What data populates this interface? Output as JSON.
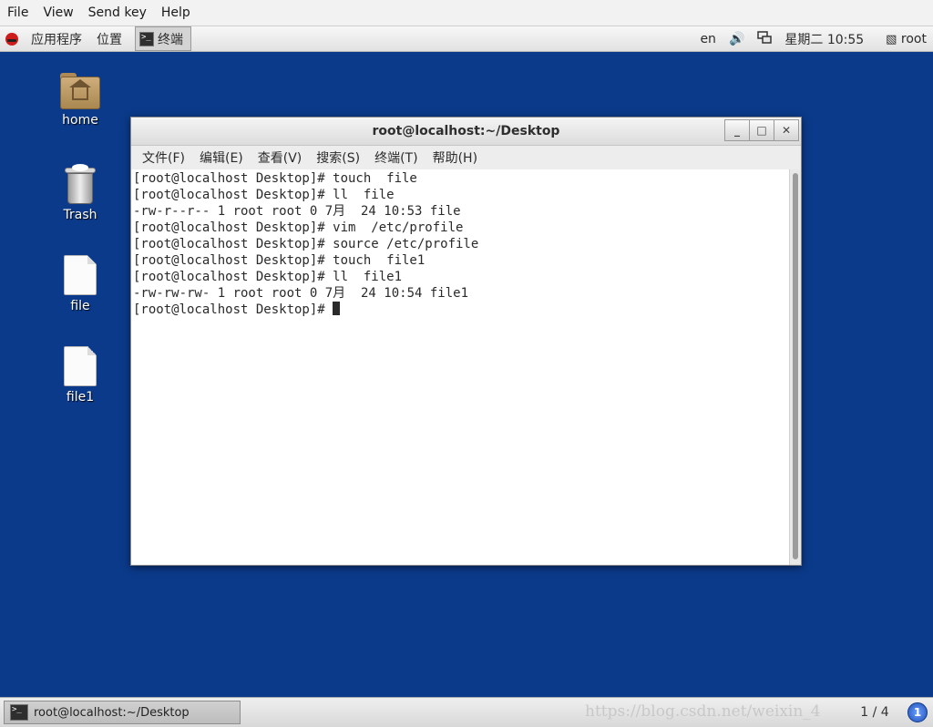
{
  "vm_menubar": {
    "items": [
      "File",
      "View",
      "Send key",
      "Help"
    ]
  },
  "top_panel": {
    "applications": "应用程序",
    "places": "位置",
    "terminal_task": "终端",
    "language": "en",
    "clock": "星期二 10:55",
    "user": "root"
  },
  "desktop": {
    "icons": [
      {
        "label": "home",
        "icon": "home-folder-icon"
      },
      {
        "label": "Trash",
        "icon": "trash-icon"
      },
      {
        "label": "file",
        "icon": "document-icon"
      },
      {
        "label": "file1",
        "icon": "document-icon"
      }
    ]
  },
  "terminal": {
    "title": "root@localhost:~/Desktop",
    "menus": [
      "文件(F)",
      "编辑(E)",
      "查看(V)",
      "搜索(S)",
      "终端(T)",
      "帮助(H)"
    ],
    "lines": [
      "[root@localhost Desktop]# touch  file",
      "[root@localhost Desktop]# ll  file",
      "-rw-r--r-- 1 root root 0 7月  24 10:53 file",
      "[root@localhost Desktop]# vim  /etc/profile",
      "[root@localhost Desktop]# source /etc/profile",
      "[root@localhost Desktop]# touch  file1",
      "[root@localhost Desktop]# ll  file1",
      "-rw-rw-rw- 1 root root 0 7月  24 10:54 file1",
      "[root@localhost Desktop]# "
    ]
  },
  "bottom_panel": {
    "task_label": "root@localhost:~/Desktop",
    "watermark": "https://blog.csdn.net/weixin_4",
    "pager": "1 / 4",
    "notification_count": "1"
  },
  "colors": {
    "desktop_bg": "#0b3a8a",
    "redhat": "#cc1c1c"
  }
}
